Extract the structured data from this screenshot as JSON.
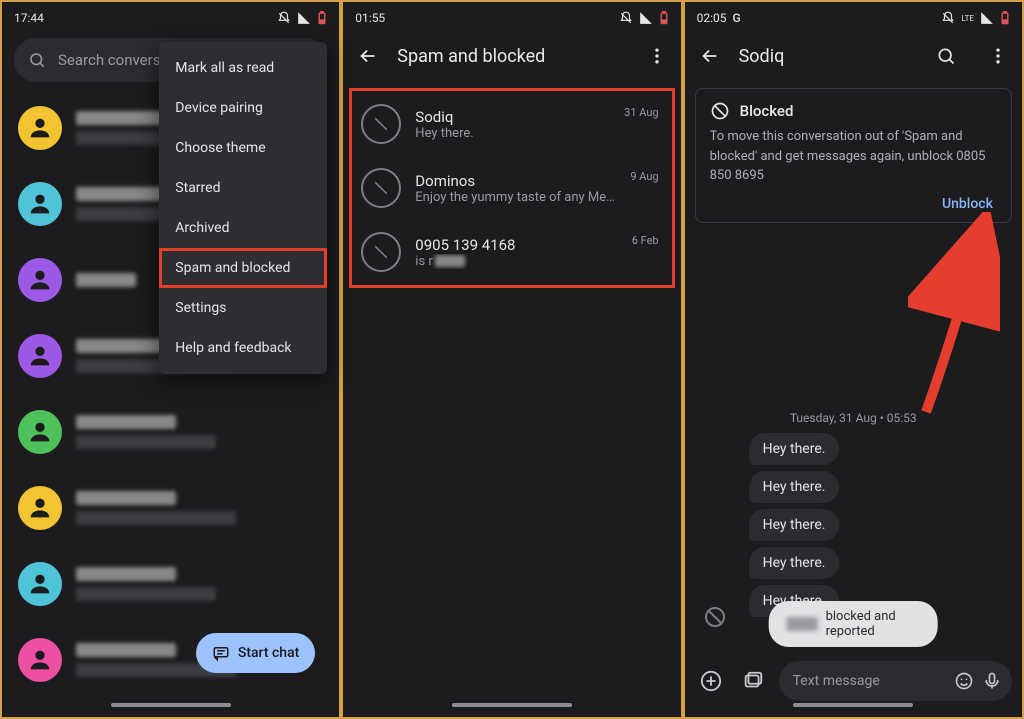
{
  "statusbar1": {
    "time": "17:44"
  },
  "statusbar2": {
    "time": "01:55"
  },
  "statusbar3": {
    "time": "02:05",
    "extra": "G",
    "net": "LTE"
  },
  "search": {
    "placeholder": "Search conversat"
  },
  "overflow": {
    "items": [
      "Mark all as read",
      "Device pairing",
      "Choose theme",
      "Starred",
      "Archived",
      "Spam and blocked",
      "Settings",
      "Help and feedback"
    ]
  },
  "fab": {
    "label": "Start chat"
  },
  "screen2": {
    "title": "Spam and blocked",
    "items": [
      {
        "name": "Sodiq",
        "preview": "Hey there.",
        "date": "31 Aug"
      },
      {
        "name": "Dominos",
        "preview": "Enjoy the yummy taste of any Medium …",
        "date": "9 Aug"
      },
      {
        "name": "0905 139 4168",
        "preview": "is r",
        "date": "6 Feb"
      }
    ]
  },
  "screen3": {
    "title": "Sodiq",
    "card_title": "Blocked",
    "card_body": "To move this conversation out of 'Spam and blocked' and get messages again, unblock 0805 850 8695",
    "unblock": "Unblock",
    "timestamp": "Tuesday, 31 Aug • 05:53",
    "messages": [
      "Hey there.",
      "Hey there.",
      "Hey there.",
      "Hey there.",
      "Hey there."
    ],
    "snackbar": "blocked and reported",
    "composer_placeholder": "Text message"
  },
  "avatar_colors": [
    "#f2c431",
    "#4fc4d8",
    "#9b59e6",
    "#9b59e6",
    "#4fc15a",
    "#f2c431",
    "#4fc4d8",
    "#ef4fa0"
  ]
}
